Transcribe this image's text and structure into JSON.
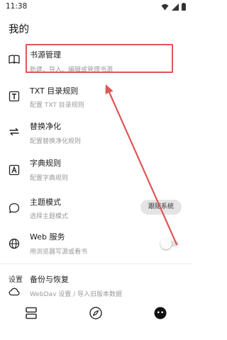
{
  "status": {
    "time": "11:38"
  },
  "page": {
    "title": "我的"
  },
  "items": [
    {
      "title": "书源管理",
      "subtitle": "新建、导入、编辑或管理书源",
      "icon": "book-open-icon"
    },
    {
      "title": "TXT 目录规则",
      "subtitle": "配置 TXT 目录规则",
      "icon": "t-box-icon"
    },
    {
      "title": "替换净化",
      "subtitle": "配置替换净化规则",
      "icon": "swap-arrows-icon"
    },
    {
      "title": "字典规则",
      "subtitle": "配置字典规则",
      "icon": "a-box-icon"
    },
    {
      "title": "主题模式",
      "subtitle": "选择主题模式",
      "icon": "speech-bubble-icon",
      "value": "跟随系统"
    },
    {
      "title": "Web 服务",
      "subtitle": "用浏览器写源或看书",
      "icon": "globe-icon",
      "enabled": false
    }
  ],
  "settings": {
    "section_title": "设置",
    "backup": {
      "title": "备份与恢复",
      "subtitle": "WebDav 设置 / 导入旧版本数据",
      "icon": "cloud-icon"
    }
  },
  "bottom_nav": [
    {
      "name": "bookshelf",
      "icon": "bookshelf-icon"
    },
    {
      "name": "discover",
      "icon": "compass-icon"
    },
    {
      "name": "my",
      "icon": "face-icon",
      "active": true
    }
  ],
  "colors": {
    "annotation": "#e05656",
    "subtitle": "#9a9a9a"
  }
}
